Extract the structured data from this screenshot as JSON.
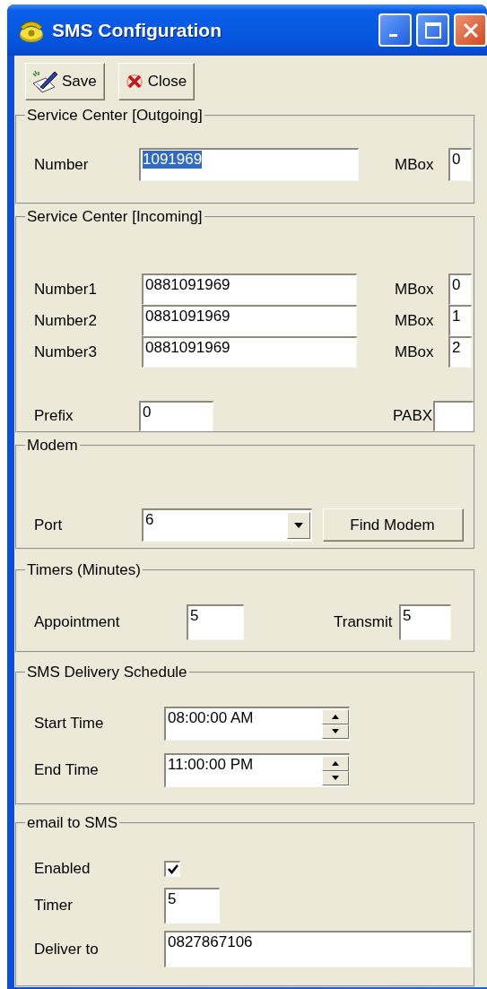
{
  "window": {
    "title": "SMS Configuration"
  },
  "toolbar": [
    {
      "kind": "save",
      "label": "Save"
    },
    {
      "kind": "close",
      "label": "Close"
    }
  ],
  "sections": [
    {
      "title": "Service Center [Outgoing]",
      "rows": [
        {
          "items": [
            {
              "kind": "label",
              "text": "Number"
            },
            {
              "kind": "text",
              "value": "1091969",
              "selected": true
            },
            {
              "kind": "label",
              "text": "MBox"
            },
            {
              "kind": "text",
              "value": "0",
              "selected": false
            }
          ]
        }
      ]
    },
    {
      "title": "Service Center [Incoming]",
      "rows": [
        {
          "items": [
            {
              "kind": "label",
              "text": "Number1"
            },
            {
              "kind": "text",
              "value": "0881091969",
              "selected": false
            },
            {
              "kind": "label",
              "text": "MBox"
            },
            {
              "kind": "text",
              "value": "0",
              "selected": false
            }
          ]
        },
        {
          "items": [
            {
              "kind": "label",
              "text": "Number2"
            },
            {
              "kind": "text",
              "value": "0881091969",
              "selected": false
            },
            {
              "kind": "label",
              "text": "MBox"
            },
            {
              "kind": "text",
              "value": "1",
              "selected": false
            }
          ]
        },
        {
          "items": [
            {
              "kind": "label",
              "text": "Number3"
            },
            {
              "kind": "text",
              "value": "0881091969",
              "selected": false
            },
            {
              "kind": "label",
              "text": "MBox"
            },
            {
              "kind": "text",
              "value": "2",
              "selected": false
            }
          ]
        },
        {
          "items": [
            {
              "kind": "label",
              "text": "Prefix"
            },
            {
              "kind": "text",
              "value": "0",
              "selected": false
            },
            {
              "kind": "label",
              "text": "PABX"
            },
            {
              "kind": "text"
            }
          ]
        }
      ]
    },
    {
      "title": "Modem",
      "rows": [
        {
          "items": [
            {
              "kind": "label",
              "text": "Port"
            },
            {
              "kind": "combo",
              "value": "6"
            },
            {
              "kind": "button",
              "label": "Find Modem"
            }
          ]
        }
      ]
    },
    {
      "title": "Timers (Minutes)",
      "rows": [
        {
          "items": [
            {
              "kind": "label",
              "text": "Appointment"
            },
            {
              "kind": "text",
              "value": "5",
              "selected": false
            },
            {
              "kind": "label",
              "text": "Transmit"
            },
            {
              "kind": "text",
              "value": "5",
              "selected": false
            }
          ]
        }
      ]
    },
    {
      "title": "SMS Delivery Schedule",
      "rows": [
        {
          "items": [
            {
              "kind": "label",
              "text": "Start Time"
            },
            {
              "kind": "spin",
              "value": "08:00:00 AM"
            }
          ]
        },
        {
          "items": [
            {
              "kind": "label",
              "text": "End Time"
            },
            {
              "kind": "spin",
              "value": "11:00:00 PM"
            }
          ]
        }
      ]
    },
    {
      "title": "email to SMS",
      "rows": [
        {
          "items": [
            {
              "kind": "label",
              "text": "Enabled"
            },
            {
              "kind": "checkbox",
              "checked": true
            }
          ]
        },
        {
          "items": [
            {
              "kind": "label",
              "text": "Timer"
            },
            {
              "kind": "text",
              "value": "5",
              "selected": false
            }
          ]
        },
        {
          "items": [
            {
              "kind": "label",
              "text": "Deliver to"
            },
            {
              "kind": "text",
              "value": "0827867106",
              "selected": false
            }
          ]
        }
      ]
    }
  ]
}
